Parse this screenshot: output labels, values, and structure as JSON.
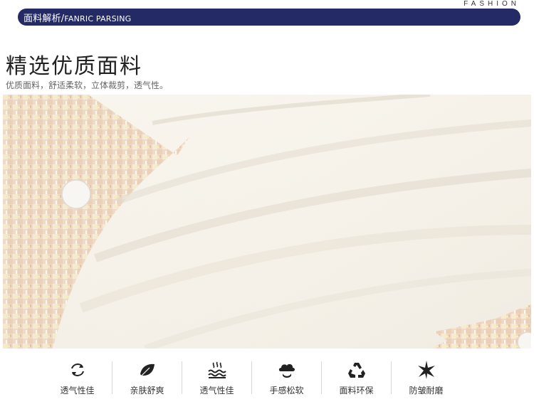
{
  "header": {
    "title_cn": "面料解析/",
    "title_en": "FANRIC PARSING",
    "fashion": "FASHION"
  },
  "main": {
    "title": "精选优质面料",
    "subtitle": "优质面料，舒适柔软，立体裁剪，透气性。"
  },
  "features": [
    {
      "label": "透气性佳",
      "icon": "swirl-arrows-icon"
    },
    {
      "label": "亲肤舒爽",
      "icon": "leaf-icon"
    },
    {
      "label": "透气性佳",
      "icon": "waves-icon"
    },
    {
      "label": "手感松软",
      "icon": "cloud-hand-icon"
    },
    {
      "label": "面料环保",
      "icon": "recycle-icon"
    },
    {
      "label": "防皱耐磨",
      "icon": "star-burst-icon"
    }
  ]
}
